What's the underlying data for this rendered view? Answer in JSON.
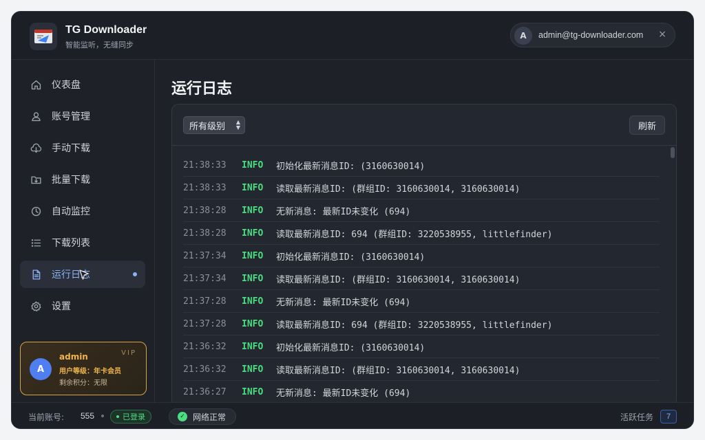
{
  "app": {
    "title": "TG Downloader",
    "subtitle": "智能监听，无缝同步",
    "logo_icon": "app-logo-icon"
  },
  "user": {
    "avatar_letter": "A",
    "email": "admin@tg-downloader.com"
  },
  "sidebar": {
    "items": [
      {
        "label": "仪表盘",
        "icon": "home-icon",
        "active": false
      },
      {
        "label": "账号管理",
        "icon": "user-icon",
        "active": false
      },
      {
        "label": "手动下载",
        "icon": "cloud-download-icon",
        "active": false
      },
      {
        "label": "批量下载",
        "icon": "folder-download-icon",
        "active": false
      },
      {
        "label": "自动监控",
        "icon": "clock-icon",
        "active": false
      },
      {
        "label": "下载列表",
        "icon": "list-icon",
        "active": false
      },
      {
        "label": "运行日志",
        "icon": "document-icon",
        "active": true
      },
      {
        "label": "设置",
        "icon": "gear-icon",
        "active": false
      }
    ]
  },
  "vip_card": {
    "avatar_letter": "A",
    "name": "admin",
    "level": "用户等级：年卡会员",
    "points": "剩余积分：无限",
    "badge": "VIP"
  },
  "main": {
    "title": "运行日志",
    "level_filter": "所有级别",
    "refresh_label": "刷新"
  },
  "logs": [
    {
      "time": "21:38:33",
      "level": "INFO",
      "message": "初始化最新消息ID: (3160630014)"
    },
    {
      "time": "21:38:33",
      "level": "INFO",
      "message": "读取最新消息ID: (群组ID: 3160630014, 3160630014)"
    },
    {
      "time": "21:38:28",
      "level": "INFO",
      "message": "无新消息: 最新ID未变化 (694)"
    },
    {
      "time": "21:38:28",
      "level": "INFO",
      "message": "读取最新消息ID: 694 (群组ID: 3220538955, littlefinder)"
    },
    {
      "time": "21:37:34",
      "level": "INFO",
      "message": "初始化最新消息ID: (3160630014)"
    },
    {
      "time": "21:37:34",
      "level": "INFO",
      "message": "读取最新消息ID: (群组ID: 3160630014, 3160630014)"
    },
    {
      "time": "21:37:28",
      "level": "INFO",
      "message": "无新消息: 最新ID未变化 (694)"
    },
    {
      "time": "21:37:28",
      "level": "INFO",
      "message": "读取最新消息ID: 694 (群组ID: 3220538955, littlefinder)"
    },
    {
      "time": "21:36:32",
      "level": "INFO",
      "message": "初始化最新消息ID: (3160630014)"
    },
    {
      "time": "21:36:32",
      "level": "INFO",
      "message": "读取最新消息ID: (群组ID: 3160630014, 3160630014)"
    },
    {
      "time": "21:36:27",
      "level": "INFO",
      "message": "无新消息: 最新ID未变化 (694)"
    }
  ],
  "footer": {
    "account_label": "当前账号:",
    "account_value": "555",
    "login_status": "已登录",
    "network_status": "网络正常",
    "tasks_label": "活跃任务",
    "tasks_count": "7"
  },
  "colors": {
    "accent": "#8ab4f8",
    "info": "#4ade80",
    "vip_gold": "#f0b64e"
  }
}
